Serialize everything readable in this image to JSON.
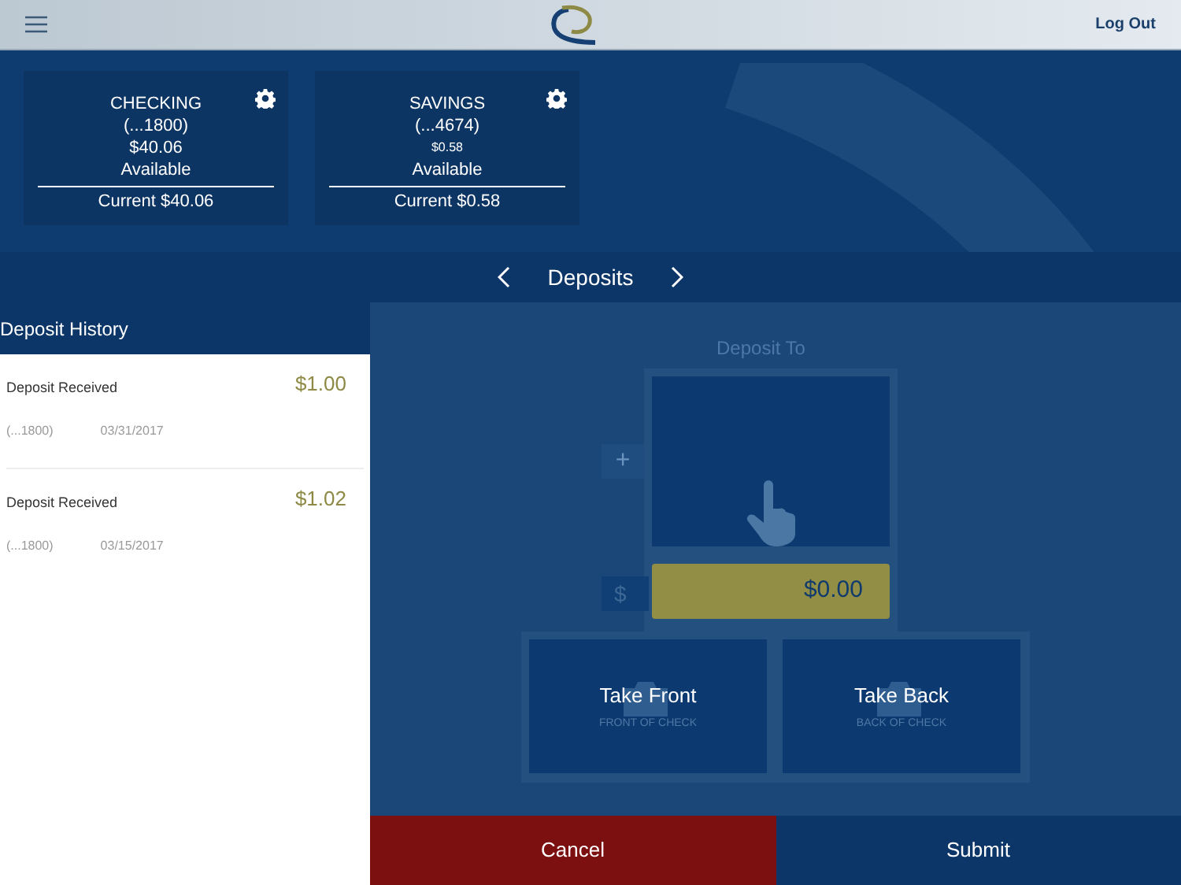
{
  "header": {
    "logout": "Log Out"
  },
  "accounts": [
    {
      "name": "CHECKING",
      "number": "(...1800)",
      "balance": "$40.06",
      "compact": false,
      "available_label": "Available",
      "current": "Current $40.06"
    },
    {
      "name": "SAVINGS",
      "number": "(...4674)",
      "balance": "$0.58",
      "compact": true,
      "available_label": "Available",
      "current": "Current $0.58"
    }
  ],
  "nav": {
    "title": "Deposits"
  },
  "history": {
    "title": "Deposit History",
    "items": [
      {
        "label": "Deposit Received",
        "amount": "$1.00",
        "account": "(...1800)",
        "date": "03/31/2017"
      },
      {
        "label": "Deposit Received",
        "amount": "$1.02",
        "account": "(...1800)",
        "date": "03/15/2017"
      }
    ]
  },
  "deposit": {
    "heading": "Deposit To",
    "add_symbol": "+",
    "currency_symbol": "$",
    "amount": "$0.00",
    "capture": [
      {
        "label": "Take Front",
        "caption": "FRONT OF CHECK"
      },
      {
        "label": "Take Back",
        "caption": "BACK OF CHECK"
      }
    ]
  },
  "actions": [
    {
      "label": "Cancel",
      "kind": "cancel"
    },
    {
      "label": "Submit",
      "kind": "submit"
    }
  ]
}
